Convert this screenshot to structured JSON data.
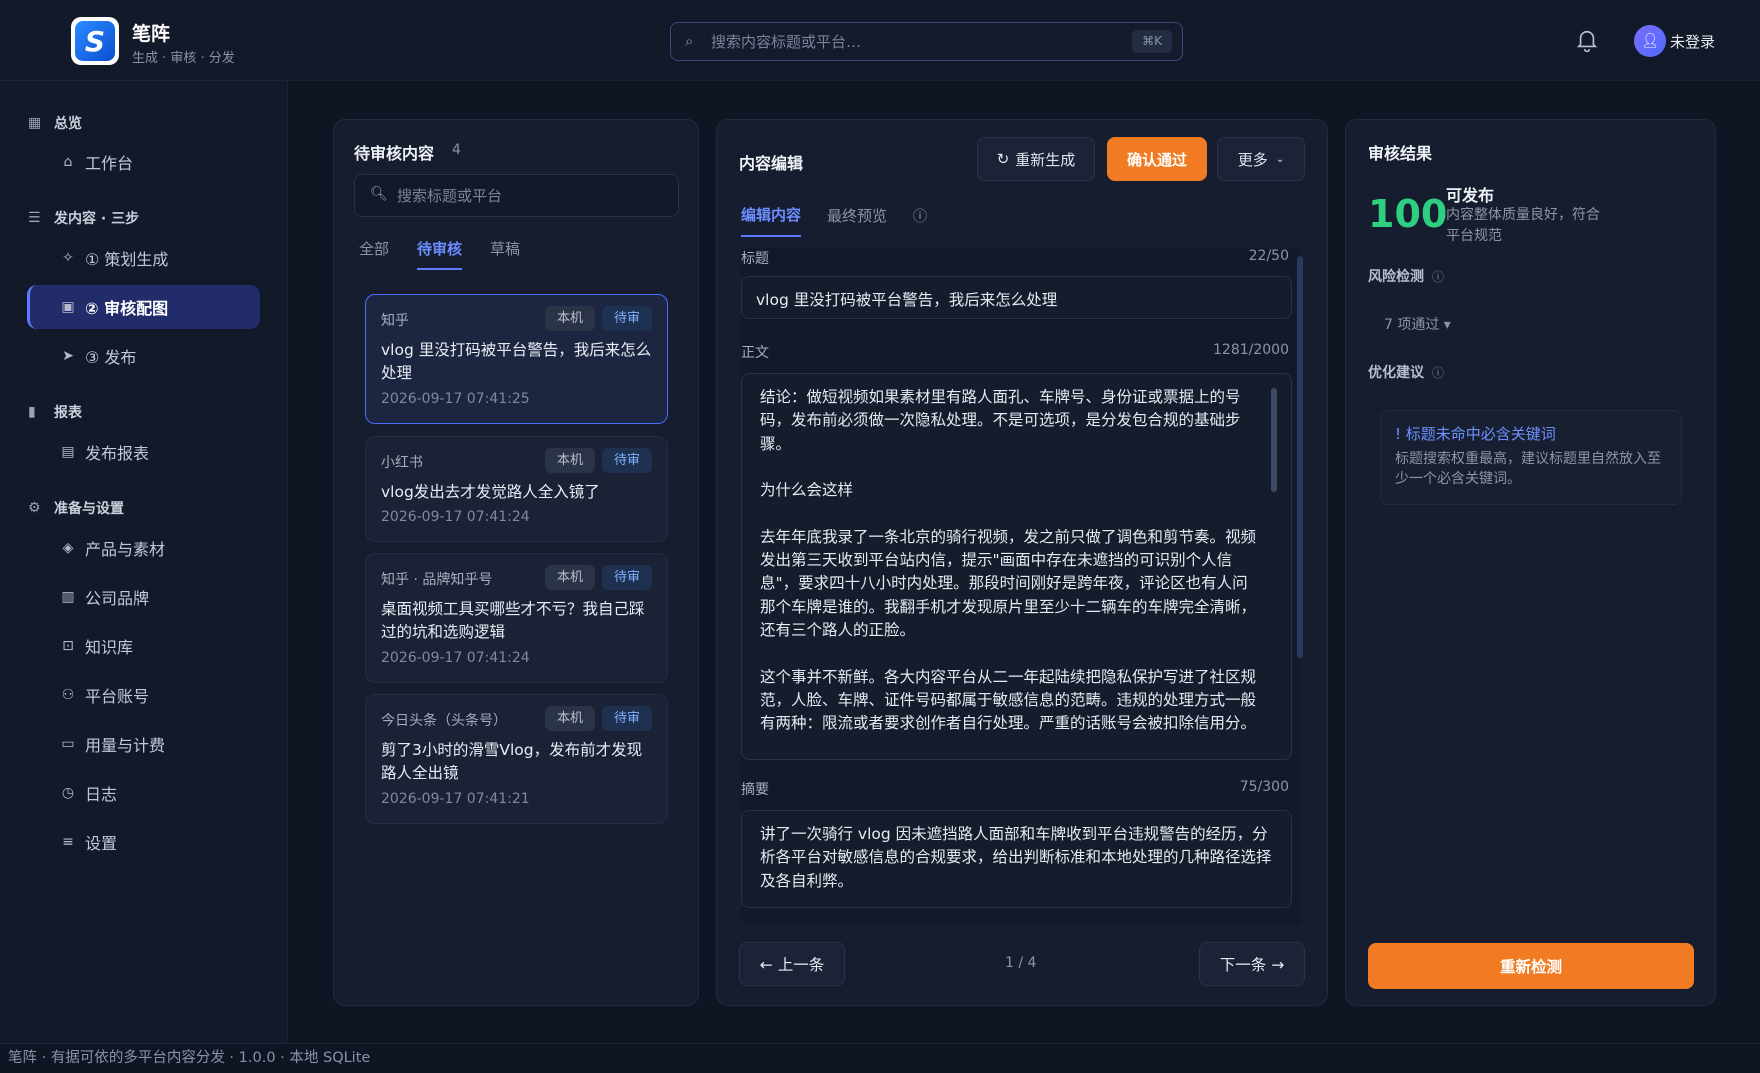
{
  "app": {
    "name": "笔阵",
    "tagline": "生成 · 审核 · 分发"
  },
  "header": {
    "search_placeholder": "搜索内容标题或平台…",
    "search_shortcut": "⌘K",
    "user_label": "未登录"
  },
  "sidebar": {
    "groups": [
      {
        "label": "总览",
        "items": [
          {
            "label": "工作台"
          }
        ]
      },
      {
        "label": "发内容 · 三步",
        "items": [
          {
            "label": "① 策划生成"
          },
          {
            "label": "② 审核配图"
          },
          {
            "label": "③ 发布"
          }
        ]
      },
      {
        "label": "报表",
        "items": [
          {
            "label": "发布报表"
          }
        ]
      },
      {
        "label": "准备与设置",
        "items": [
          {
            "label": "产品与素材"
          },
          {
            "label": "公司品牌"
          },
          {
            "label": "知识库"
          },
          {
            "label": "平台账号"
          },
          {
            "label": "用量与计费"
          },
          {
            "label": "日志"
          },
          {
            "label": "设置"
          }
        ]
      }
    ]
  },
  "queue": {
    "title": "待审核内容",
    "count": "4",
    "search_placeholder": "搜索标题或平台",
    "tabs": [
      "全部",
      "待审核",
      "草稿"
    ],
    "cards": [
      {
        "platform": "知乎",
        "local": "本机",
        "status": "待审",
        "title": "vlog 里没打码被平台警告，我后来怎么处理",
        "time": "2026-09-17 07:41:25"
      },
      {
        "platform": "小红书",
        "local": "本机",
        "status": "待审",
        "title": "vlog发出去才发觉路人全入镜了",
        "time": "2026-09-17 07:41:24"
      },
      {
        "platform": "知乎 · 品牌知乎号",
        "local": "本机",
        "status": "待审",
        "title": "桌面视频工具买哪些才不亏？我自己踩过的坑和选购逻辑",
        "time": "2026-09-17 07:41:24"
      },
      {
        "platform": "今日头条（头条号）",
        "local": "本机",
        "status": "待审",
        "title": "剪了3小时的滑雪Vlog，发布前才发现路人全出镜",
        "time": "2026-09-17 07:41:21"
      }
    ]
  },
  "editor": {
    "title": "内容编辑",
    "regenerate_label": "重新生成",
    "confirm_label": "确认通过",
    "more_label": "更多",
    "tabs": [
      "编辑内容",
      "最终预览"
    ],
    "title_field": {
      "label": "标题",
      "count": "22/50",
      "value": "vlog 里没打码被平台警告，我后来怎么处理"
    },
    "body_field": {
      "label": "正文",
      "count": "1281/2000",
      "paragraphs": [
        "结论：做短视频如果素材里有路人面孔、车牌号、身份证或票据上的号码，发布前必须做一次隐私处理。不是可选项，是分发包合规的基础步骤。",
        "为什么会这样",
        "去年年底我录了一条北京的骑行视频，发之前只做了调色和剪节奏。视频发出第三天收到平台站内信，提示\"画面中存在未遮挡的可识别个人信息\"，要求四十八小时内处理。那段时间刚好是跨年夜，评论区也有人问那个车牌是谁的。我翻手机才发现原片里至少十二辆车的车牌完全清晰，还有三个路人的正脸。",
        "这个事并不新鲜。各大内容平台从二一年起陆续把隐私保护写进了社区规范，人脸、车牌、证件号码都属于敏感信息的范畴。违规的处理方式一般有两种：限流或者要求创作者自行处理。严重的话账号会被扣除信用分。"
      ]
    },
    "summary_field": {
      "label": "摘要",
      "count": "75/300",
      "value": "讲了一次骑行 vlog 因未遮挡路人面部和车牌收到平台违规警告的经历，分析各平台对敏感信息的合规要求，给出判断标准和本地处理的几种路径选择及各自利弊。"
    },
    "prev_label": "← 上一条",
    "next_label": "下一条 →",
    "pager": "1 / 4"
  },
  "review": {
    "title": "审核结果",
    "score": "100",
    "state": "可发布",
    "state_desc": "内容整体质量良好，符合平台规范",
    "risk_label": "风险检测",
    "risk_pass": "7 项通过 ▾",
    "suggest_label": "优化建议",
    "suggestion_title": "! 标题未命中必含关键词",
    "suggestion_desc": "标题搜索权重最高，建议标题里自然放入至少一个必含关键词。",
    "recheck_label": "重新检测"
  },
  "footer": {
    "text": "笔阵 · 有据可依的多平台内容分发  ·  1.0.0  ·  本地 SQLite"
  },
  "colors": {
    "accent": "#5d7bff",
    "orange": "#f07b22",
    "score_green": "#2ecf80"
  }
}
